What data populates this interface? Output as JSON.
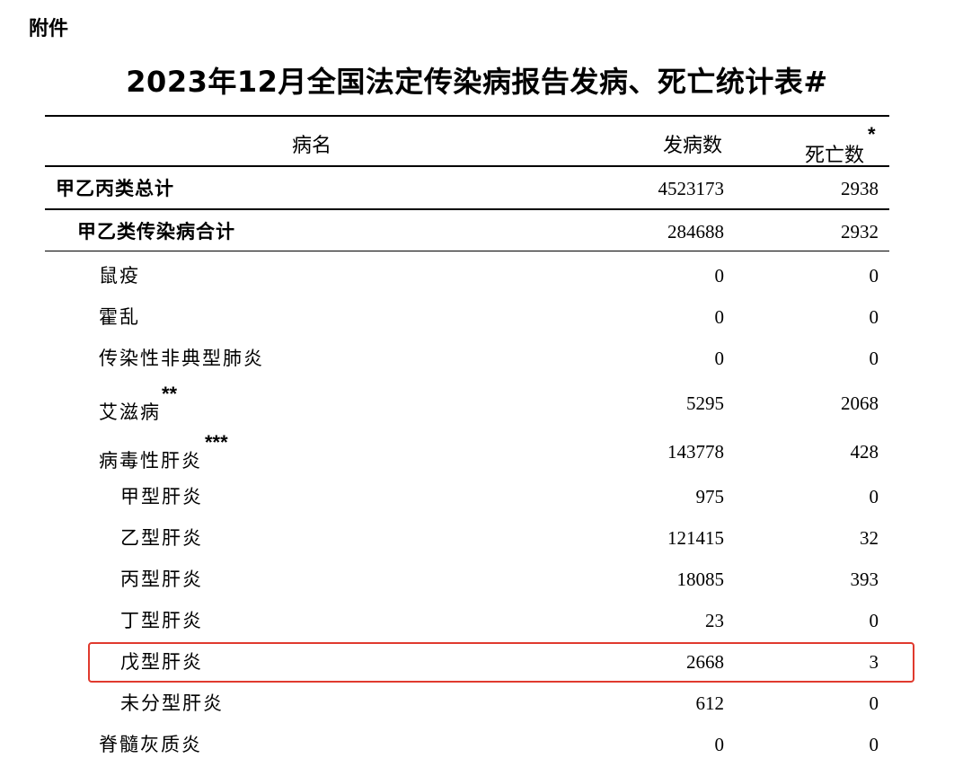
{
  "attachment_label": "附件",
  "title": "2023年12月全国法定传染病报告发病、死亡统计表#",
  "header": {
    "name": "病名",
    "cases": "发病数",
    "deaths": "死亡数",
    "deaths_mark": "*"
  },
  "rows": [
    {
      "name": "甲乙丙类总计",
      "cases": "4523173",
      "deaths": "2938",
      "mark": ""
    },
    {
      "name": "甲乙类传染病合计",
      "cases": "284688",
      "deaths": "2932",
      "mark": ""
    },
    {
      "name": "鼠疫",
      "cases": "0",
      "deaths": "0",
      "mark": ""
    },
    {
      "name": "霍乱",
      "cases": "0",
      "deaths": "0",
      "mark": ""
    },
    {
      "name": "传染性非典型肺炎",
      "cases": "0",
      "deaths": "0",
      "mark": ""
    },
    {
      "name": "艾滋病",
      "cases": "5295",
      "deaths": "2068",
      "mark": "**"
    },
    {
      "name": "病毒性肝炎",
      "cases": "143778",
      "deaths": "428",
      "mark": "***"
    },
    {
      "name": "甲型肝炎",
      "cases": "975",
      "deaths": "0",
      "mark": ""
    },
    {
      "name": "乙型肝炎",
      "cases": "121415",
      "deaths": "32",
      "mark": ""
    },
    {
      "name": "丙型肝炎",
      "cases": "18085",
      "deaths": "393",
      "mark": ""
    },
    {
      "name": "丁型肝炎",
      "cases": "23",
      "deaths": "0",
      "mark": ""
    },
    {
      "name": "戊型肝炎",
      "cases": "2668",
      "deaths": "3",
      "mark": ""
    },
    {
      "name": "未分型肝炎",
      "cases": "612",
      "deaths": "0",
      "mark": ""
    },
    {
      "name": "脊髓灰质炎",
      "cases": "0",
      "deaths": "0",
      "mark": ""
    }
  ],
  "highlight_color": "#e03a2e"
}
